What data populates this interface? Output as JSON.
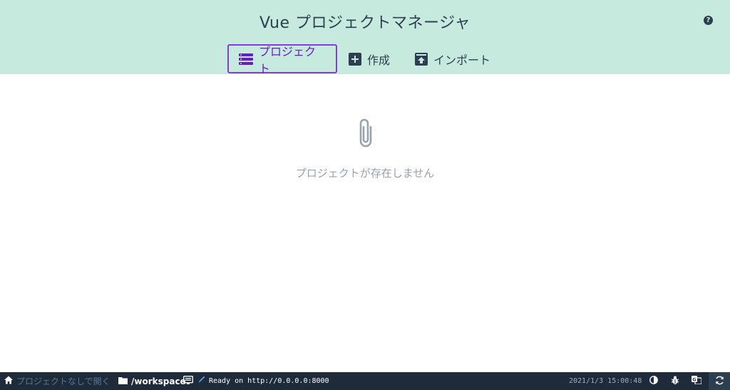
{
  "app": {
    "title": "Vue プロジェクトマネージャ"
  },
  "header": {
    "help_icon": "question-circle-icon",
    "tabs": [
      {
        "label": "プロジェクト",
        "icon": "list-icon",
        "active": true
      },
      {
        "label": "作成",
        "icon": "plus-square-icon",
        "active": false
      },
      {
        "label": "インポート",
        "icon": "import-icon",
        "active": false
      }
    ]
  },
  "main": {
    "empty_icon": "paperclip-icon",
    "empty_text": "プロジェクトが存在しません"
  },
  "statusbar": {
    "home_label": "プロジェクトなしで開く",
    "folder_label": "/workspace",
    "log_text": "Ready on http://0.0.0.0:8000",
    "timestamp": "2021/1/3 15:00:48",
    "buttons": [
      "theme-toggle-icon",
      "bug-icon",
      "translate-icon",
      "refresh-icon"
    ]
  },
  "colors": {
    "header_bg": "#c6eadd",
    "accent": "#8a3ad6",
    "text_dark": "#2c3e50",
    "muted": "#97a1ab",
    "statusbar_bg": "#1d2b3a"
  }
}
